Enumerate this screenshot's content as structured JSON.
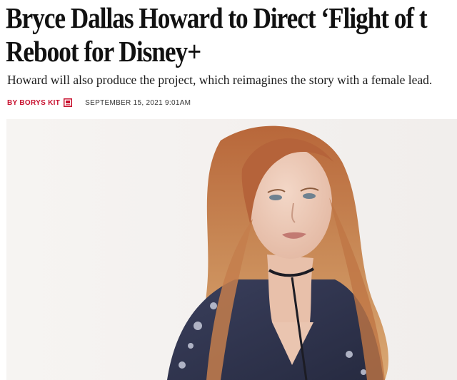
{
  "article": {
    "headline_line1": "Bryce Dallas Howard to Direct ‘Flight of t",
    "headline_line2": "Reboot for Disney+",
    "dek": "Howard will also produce the project, which reimagines the story with a female lead.",
    "byline": "BY BORYS KIT",
    "date": "SEPTEMBER 15, 2021 9:01AM"
  },
  "icons": {
    "author": "author-page-icon"
  },
  "colors": {
    "byline_accent": "#c8102e",
    "headline": "#111111",
    "background": "#ffffff"
  }
}
